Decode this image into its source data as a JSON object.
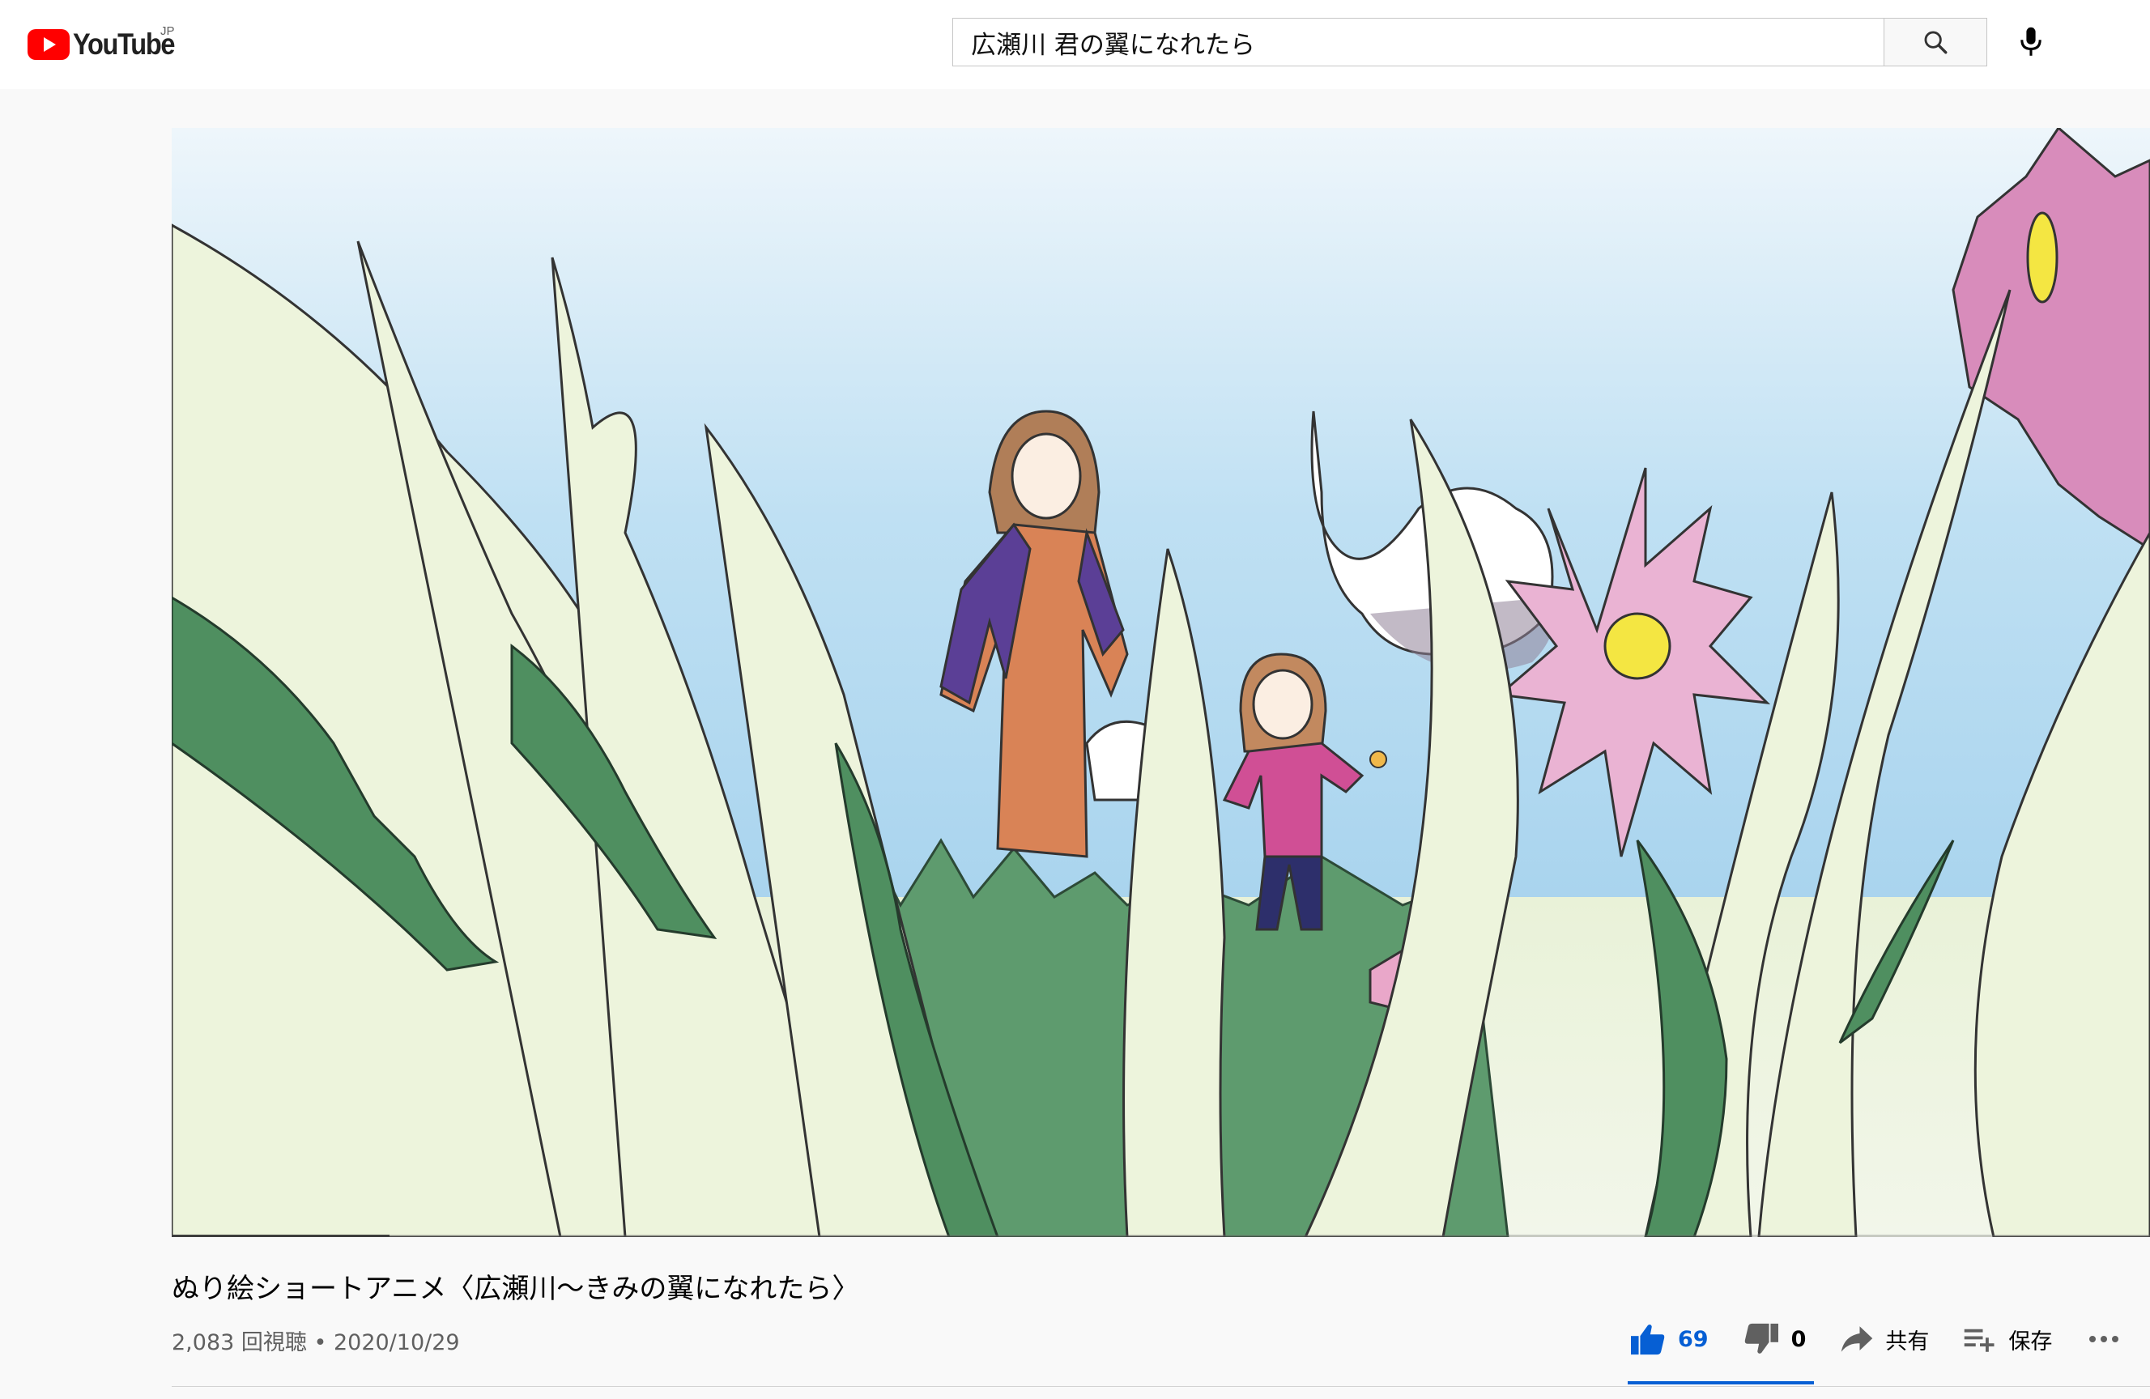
{
  "header": {
    "logo_text": "YouTube",
    "region": "JP",
    "search_value": "広瀬川 君の翼になれたら",
    "search_icon": "search-icon",
    "mic_icon": "mic-icon"
  },
  "player": {
    "thumbnail": "crayon-drawn animation frame: mother and child among grass and flowers",
    "progress_fraction": 0.11
  },
  "video": {
    "title": "ぬり絵ショートアニメ〈広瀬川〜きみの翼になれたら〉",
    "meta": "2,083 回視聴 • 2020/10/29"
  },
  "actions": {
    "like_count": "69",
    "dislike_count": "0",
    "share_label": "共有",
    "save_label": "保存",
    "more_icon": "more-icon"
  },
  "colors": {
    "brand_red": "#ff0000",
    "like_blue": "#065fd4"
  }
}
